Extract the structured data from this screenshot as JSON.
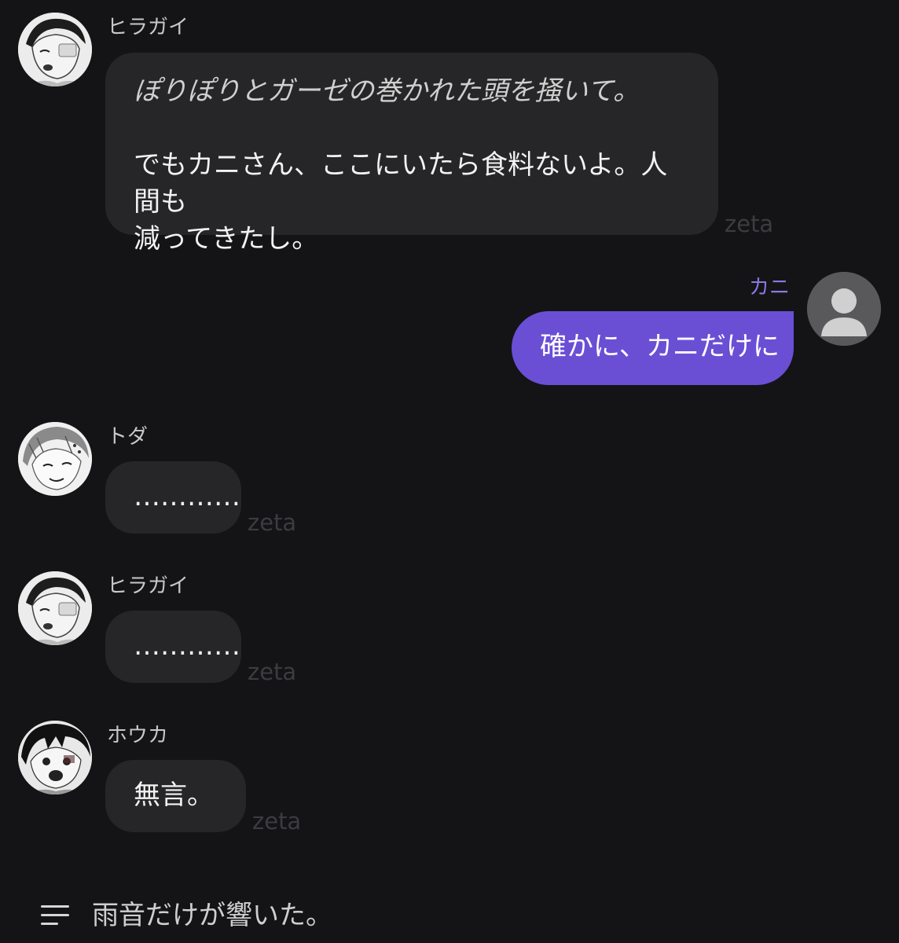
{
  "messages": [
    {
      "sender": "ヒラガイ",
      "narration": "ぽりぽりとガーゼの巻かれた頭を掻いて。",
      "line1": "でもカニさん、ここにいたら食料ないよ。人間も",
      "line2": "減ってきたし。",
      "watermark": "zeta"
    },
    {
      "sender": "カニ",
      "text": "確かに、カニだけに"
    },
    {
      "sender": "トダ",
      "text": "…………",
      "watermark": "zeta"
    },
    {
      "sender": "ヒラガイ",
      "text": "…………",
      "watermark": "zeta"
    },
    {
      "sender": "ホウカ",
      "text": "無言。",
      "watermark": "zeta"
    }
  ],
  "composer": {
    "text": "雨音だけが響いた。",
    "menu_icon": "menu-lines-icon"
  },
  "colors": {
    "background": "#141416",
    "bubble": "#262628",
    "user_bubble": "#6a4fd5",
    "user_name": "#8b78e6"
  }
}
